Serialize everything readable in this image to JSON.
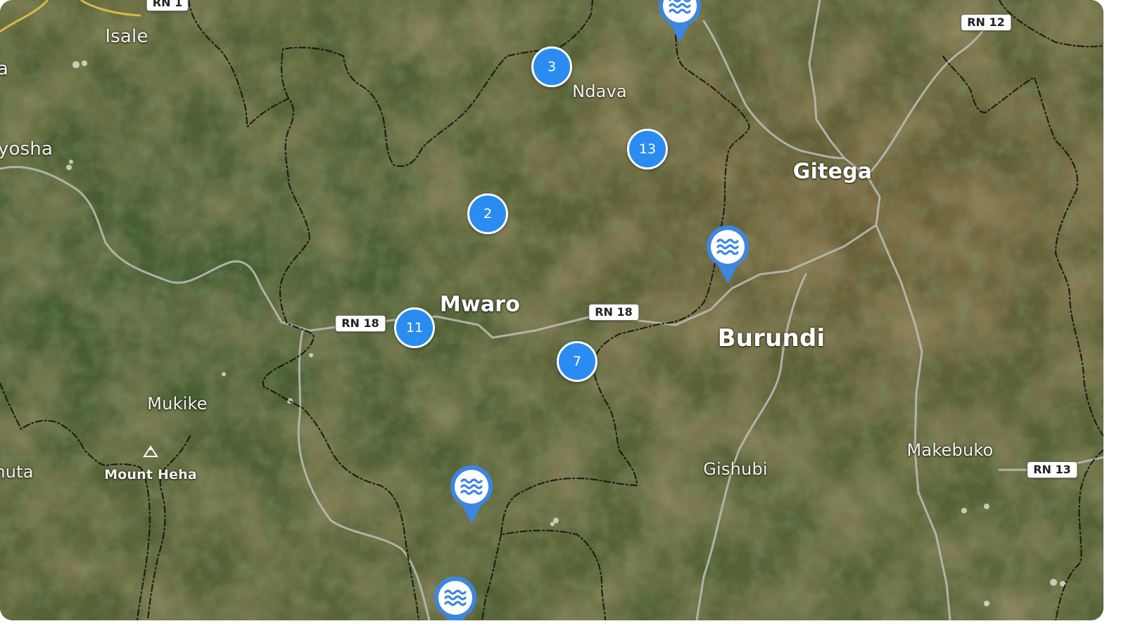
{
  "map": {
    "colors": {
      "cluster_fill": "#2a8cf0",
      "pin_fill": "#3d86e0",
      "boundary": "#1a1a1a",
      "road": "#b9b9b4"
    },
    "places": {
      "isale": "Isale",
      "yosha": "yosha",
      "ndava": "Ndava",
      "gitega": "Gitega",
      "mwaro": "Mwaro",
      "burundi": "Burundi",
      "mukike": "Mukike",
      "mount_heha": "Mount Heha",
      "muta": "nuta",
      "gishubi": "Gishubi",
      "makebuko": "Makebuko",
      "edge_a": "a"
    },
    "roads": {
      "rn1": "RN 1",
      "rn12": "RN 12",
      "rn18_west": "RN 18",
      "rn18_east": "RN 18",
      "rn13": "RN 13"
    },
    "clusters": {
      "c3": "3",
      "c13": "13",
      "c2": "2",
      "c11": "11",
      "c7": "7"
    },
    "pins": {
      "icon": "water-waves-icon"
    }
  }
}
